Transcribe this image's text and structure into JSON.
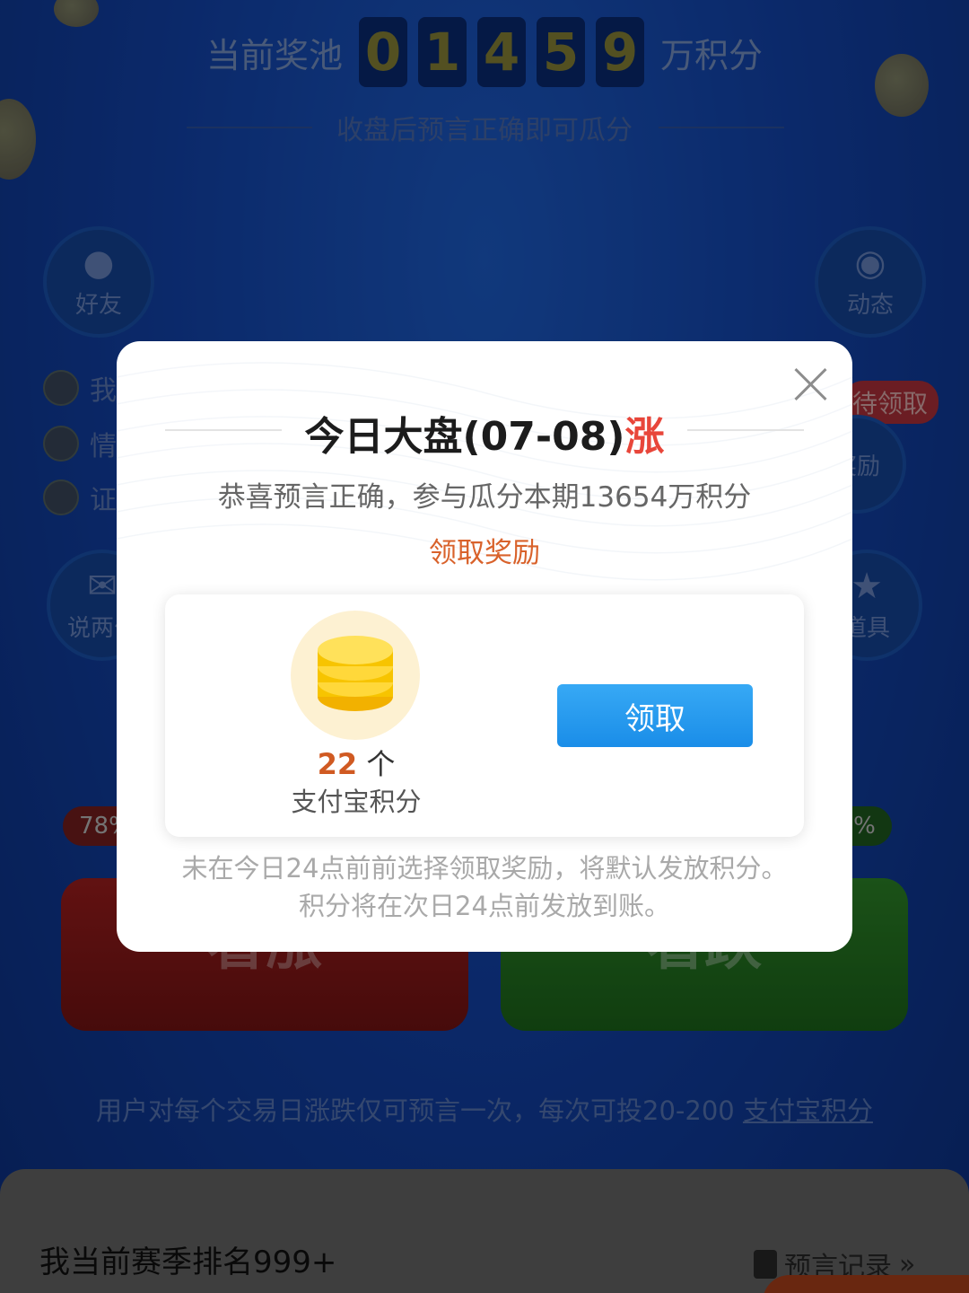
{
  "background": {
    "pool_label": "当前奖池",
    "pool_digits": [
      "0",
      "1",
      "4",
      "5",
      "9"
    ],
    "pool_unit": "万积分",
    "pool_subtitle": "收盘后预言正确即可瓜分",
    "friends_button": "好友",
    "activity_button": "动态",
    "chat_button": "说两句",
    "props_button": "道具",
    "reward_button": "奖励",
    "pending_badge": "待领取",
    "friend_feed": [
      "我",
      "情",
      "证"
    ],
    "left_percent": "78%",
    "right_percent": "22%",
    "up_button": "看涨",
    "down_button": "看跌",
    "tip_text": "用户对每个交易日涨跌仅可预言一次，每次可投20-200 ",
    "tip_link": "支付宝积分",
    "rank_text": "我当前赛季排名999+",
    "record_link": "预言记录"
  },
  "modal": {
    "title_prefix": "今日大盘(07-08)",
    "title_result": "涨",
    "congrats": "恭喜预言正确，参与瓜分本期13654万积分",
    "claim_reward_link": "领取奖励",
    "reward_amount": "22",
    "reward_unit": "个",
    "reward_name": "支付宝积分",
    "claim_button": "领取",
    "notice": "未在今日24点前前选择领取奖励，将默认发放积分。积分将在次日24点前发放到账。"
  },
  "colors": {
    "accent_blue": "#1a8de8",
    "rise_red": "#e8463a",
    "reward_orange": "#d05a22"
  }
}
